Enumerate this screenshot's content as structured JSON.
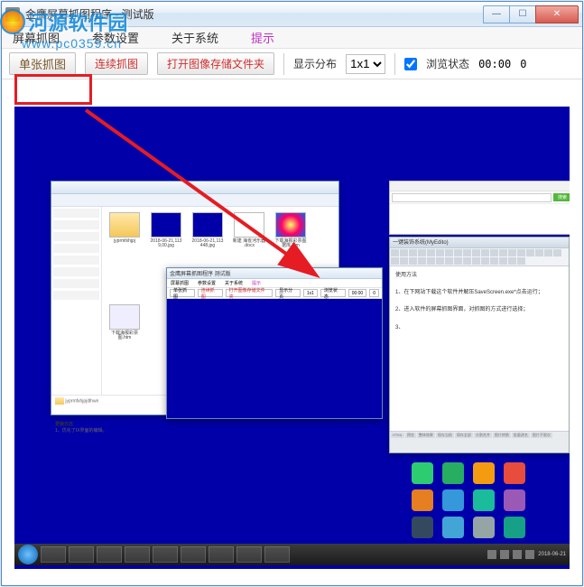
{
  "watermark": {
    "site_name": "河源软件园",
    "domain": "www.pc0359.cn"
  },
  "window": {
    "title": "金鹰屏幕抓图程序 - 测试版",
    "controls": {
      "min": "—",
      "max": "☐",
      "close": "✕"
    }
  },
  "menu": {
    "capture": "屏幕抓图",
    "settings": "参数设置",
    "about": "关于系统",
    "tip": "提示"
  },
  "toolbar": {
    "single": "单张抓图",
    "continuous": "连续抓图",
    "open_folder": "打开图像存储文件夹",
    "layout_label": "显示分布",
    "layout_value": "1x1",
    "browse_label": "浏览状态",
    "timer": "00:00",
    "counter": "0"
  },
  "inner": {
    "app_title": "金鹰屏幕抓图程序   测试版",
    "menu": {
      "capture": "屏幕抓图",
      "settings": "参数设置",
      "about": "关于系统",
      "tip": "提示"
    },
    "tool": {
      "single": "单张抓图",
      "cont": "连续抓图",
      "folder": "打开图像存储文件夹",
      "layout": "显示分页",
      "val": "1x1",
      "browse": "浏览状态",
      "time": "00:00",
      "cnt": "0"
    },
    "explorer": {
      "items": [
        {
          "cap": "jyprmfxhjpj",
          "type": "folder"
        },
        {
          "cap": "2018-06-21,113 9,00.jpg",
          "type": "navy"
        },
        {
          "cap": "2018-06-21,113 448.jpg",
          "type": "navy"
        },
        {
          "cap": "新建 海雀河乐器 .docx",
          "type": "img"
        },
        {
          "cap": "下载海报彩票图 据库.htm",
          "type": "img"
        },
        {
          "cap": "下载海报彩票图.htm",
          "type": "img"
        }
      ],
      "status_top": "更换日志",
      "status_line": "1、优化了IX界面的编辑。",
      "selected": "jyprmfxhjpjdlhwn"
    },
    "editor": {
      "title": "一键装饰系统(MyEdito)",
      "h1": "使用方法",
      "l1": "1、在下网站下载这个软件并解压SaveScreen.exe*点击运行；",
      "l2": "2、进入软件的屏幕抓图界面，对抓图的方式进行选择；",
      "l3": "3、"
    },
    "browser": {
      "go": "搜索"
    }
  },
  "taskbar": {
    "clock": "2018-06-21"
  }
}
